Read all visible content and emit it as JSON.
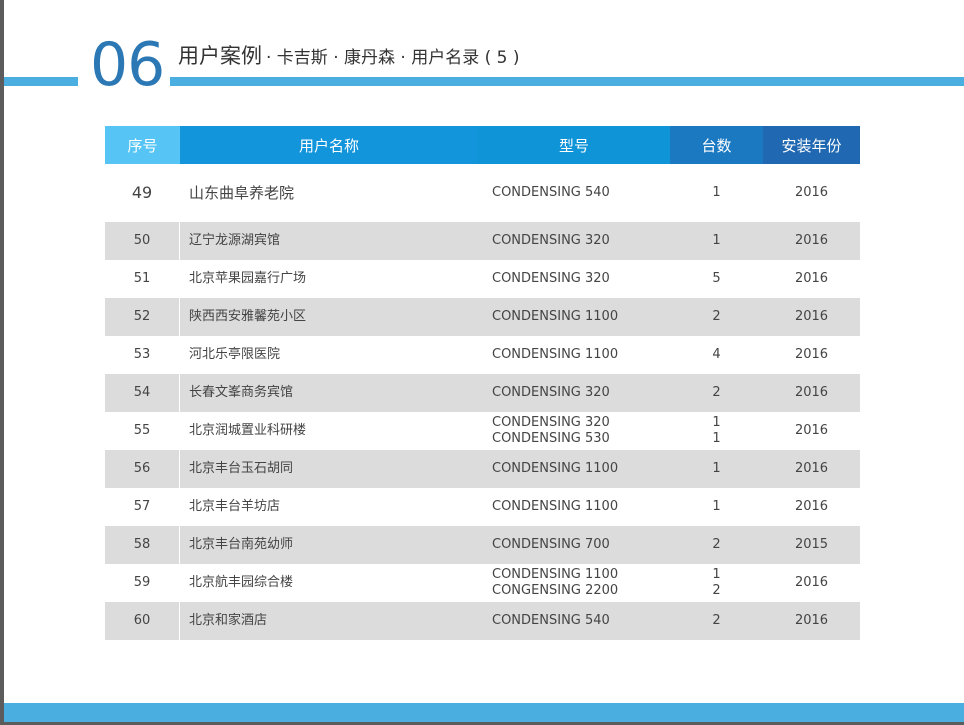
{
  "header": {
    "section_number": "06",
    "title_main": "用户案例",
    "title_sub": "· 卡吉斯 · 康丹森 · 用户名录 ( 5 )"
  },
  "table": {
    "columns": [
      "序号",
      "用户名称",
      "型号",
      "台数",
      "安装年份"
    ],
    "rows": [
      {
        "no": "49",
        "name": "山东曲阜养老院",
        "models": [
          "CONDENSING 540"
        ],
        "qty": [
          "1"
        ],
        "year": "2016"
      },
      {
        "no": "50",
        "name": "辽宁龙源湖宾馆",
        "models": [
          "CONDENSING 320"
        ],
        "qty": [
          "1"
        ],
        "year": "2016"
      },
      {
        "no": "51",
        "name": "北京苹果园嘉行广场",
        "models": [
          "CONDENSING 320"
        ],
        "qty": [
          "5"
        ],
        "year": "2016"
      },
      {
        "no": "52",
        "name": "陕西西安雅馨苑小区",
        "models": [
          "CONDENSING 1100"
        ],
        "qty": [
          "2"
        ],
        "year": "2016"
      },
      {
        "no": "53",
        "name": "河北乐亭限医院",
        "models": [
          "CONDENSING 1100"
        ],
        "qty": [
          "4"
        ],
        "year": "2016"
      },
      {
        "no": "54",
        "name": "长春文峯商务宾馆",
        "models": [
          "CONDENSING 320"
        ],
        "qty": [
          "2"
        ],
        "year": "2016"
      },
      {
        "no": "55",
        "name": "北京润城置业科研楼",
        "models": [
          "CONDENSING 320",
          "CONDENSING 530"
        ],
        "qty": [
          "1",
          "1"
        ],
        "year": "2016"
      },
      {
        "no": "56",
        "name": "北京丰台玉石胡同",
        "models": [
          "CONDENSING 1100"
        ],
        "qty": [
          "1"
        ],
        "year": "2016"
      },
      {
        "no": "57",
        "name": "北京丰台羊坊店",
        "models": [
          "CONDENSING 1100"
        ],
        "qty": [
          "1"
        ],
        "year": "2016"
      },
      {
        "no": "58",
        "name": "北京丰台南苑幼师",
        "models": [
          "CONDENSING 700"
        ],
        "qty": [
          "2"
        ],
        "year": "2015"
      },
      {
        "no": "59",
        "name": "北京航丰园综合楼",
        "models": [
          "CONDENSING 1100",
          "CONGENSING 2200"
        ],
        "qty": [
          "1",
          "2"
        ],
        "year": "2016"
      },
      {
        "no": "60",
        "name": "北京和家酒店",
        "models": [
          "CONDENSING 540"
        ],
        "qty": [
          "2"
        ],
        "year": "2016"
      }
    ]
  },
  "colors": {
    "accent_blue": "#4aaee0",
    "number_blue": "#2b78b5",
    "row_alt": "#dcdcdc"
  }
}
